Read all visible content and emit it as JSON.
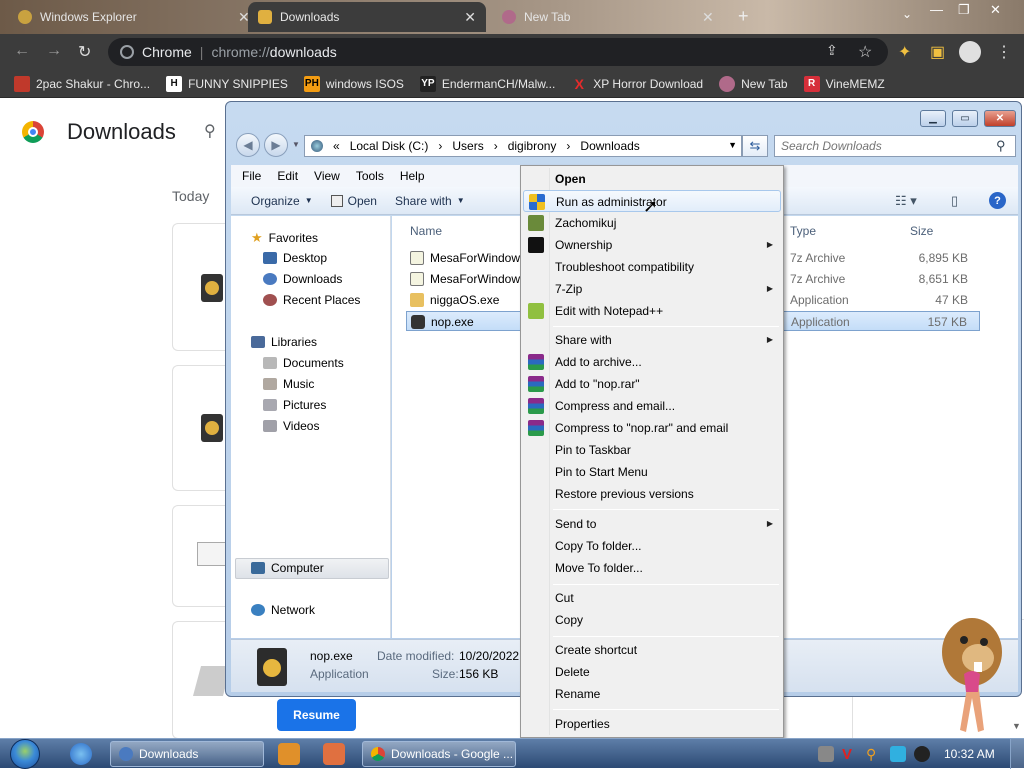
{
  "tabs": [
    {
      "label": "Windows Explorer",
      "active": false
    },
    {
      "label": "Downloads",
      "active": true
    },
    {
      "label": "New Tab",
      "active": false
    }
  ],
  "toolbar": {
    "site_name": "Chrome",
    "url_scheme": "chrome://",
    "url_path": "downloads"
  },
  "bookmarks": [
    {
      "label": "2pac Shakur - Chro...",
      "icon": "Tb",
      "color": "#c0392b"
    },
    {
      "label": "FUNNY SNIPPIES",
      "icon": "H",
      "color": "#111111"
    },
    {
      "label": "windows ISOS",
      "icon": "PH",
      "color": "#f39c12"
    },
    {
      "label": "EndermanCH/Malw...",
      "icon": "YP",
      "color": "#222222"
    },
    {
      "label": "XP Horror Download",
      "icon": "X",
      "color": "#e52b2b"
    },
    {
      "label": "New Tab",
      "icon": "",
      "color": "#b06a8a"
    },
    {
      "label": "VineMEMZ",
      "icon": "R",
      "color": "#d62f3a"
    }
  ],
  "chrome_page": {
    "title": "Downloads",
    "section": "Today",
    "resume_label": "Resume"
  },
  "explorer": {
    "address": {
      "prefix": "«",
      "crumbs": [
        "Local Disk (C:)",
        "Users",
        "digibrony",
        "Downloads"
      ]
    },
    "search_placeholder": "Search Downloads",
    "menu": [
      "File",
      "Edit",
      "View",
      "Tools",
      "Help"
    ],
    "commands": {
      "organize": "Organize",
      "open": "Open",
      "share_with": "Share with"
    },
    "nav": {
      "favorites": "Favorites",
      "favorites_items": [
        "Desktop",
        "Downloads",
        "Recent Places"
      ],
      "libraries": "Libraries",
      "libraries_items": [
        "Documents",
        "Music",
        "Pictures",
        "Videos"
      ],
      "computer": "Computer",
      "network": "Network"
    },
    "columns": {
      "name": "Name",
      "type": "Type",
      "size": "Size"
    },
    "files": [
      {
        "name": "MesaForWindow",
        "type": "7z Archive",
        "size": "6,895 KB",
        "selected": false
      },
      {
        "name": "MesaForWindow",
        "type": "7z Archive",
        "size": "8,651 KB",
        "selected": false
      },
      {
        "name": "niggaOS.exe",
        "type": "Application",
        "size": "47 KB",
        "selected": false
      },
      {
        "name": "nop.exe",
        "type": "Application",
        "size": "157 KB",
        "selected": true
      }
    ],
    "details": {
      "filename": "nop.exe",
      "kind": "Application",
      "date_label": "Date modified:",
      "date_value": "10/20/2022",
      "size_label": "Size:",
      "size_value": "156 KB"
    }
  },
  "context_menu": {
    "items": [
      {
        "label": "Open",
        "bold": true
      },
      {
        "label": "Run as administrator",
        "hover": true,
        "icon": "shield"
      },
      {
        "label": "Zachomikuj",
        "icon": "hamster"
      },
      {
        "label": "Ownership",
        "submenu": true,
        "icon": "cmd"
      },
      {
        "label": "Troubleshoot compatibility"
      },
      {
        "label": "7-Zip",
        "submenu": true
      },
      {
        "label": "Edit with Notepad++",
        "icon": "notepad"
      },
      {
        "label": "Share with",
        "submenu": true
      },
      {
        "label": "Add to archive...",
        "icon": "winrar"
      },
      {
        "label": "Add to \"nop.rar\"",
        "icon": "winrar"
      },
      {
        "label": "Compress and email...",
        "icon": "winrar"
      },
      {
        "label": "Compress to \"nop.rar\" and email",
        "icon": "winrar"
      },
      {
        "label": "Pin to Taskbar"
      },
      {
        "label": "Pin to Start Menu"
      },
      {
        "label": "Restore previous versions"
      },
      {
        "label": "Send to",
        "submenu": true
      },
      {
        "label": "Copy To folder..."
      },
      {
        "label": "Move To folder..."
      },
      {
        "label": "Cut"
      },
      {
        "label": "Copy"
      },
      {
        "label": "Create shortcut"
      },
      {
        "label": "Delete"
      },
      {
        "label": "Rename"
      },
      {
        "label": "Properties"
      }
    ]
  },
  "taskbar": {
    "tasks": [
      {
        "label": "Downloads"
      },
      {
        "label": "Downloads - Google ..."
      }
    ],
    "clock": "10:32 AM"
  },
  "colors": {
    "chrome_dark": "#3c3c3c",
    "resume_blue": "#1a73e8",
    "selection_blue": "#c4ddf8",
    "taskbar": "#2c4a74"
  }
}
